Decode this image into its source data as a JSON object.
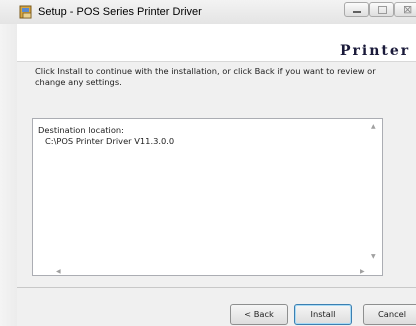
{
  "window": {
    "title": "Setup - POS Series Printer Driver",
    "controls": {
      "minimize": "minimize-icon",
      "maximize": "maximize-icon",
      "close": "close-icon",
      "close_glyph": "⊠"
    }
  },
  "header": {
    "title": "Printer"
  },
  "body": {
    "instructions": "Click Install to continue with the installation, or click Back if you want to review or change any settings.",
    "destination_label": "Destination location:",
    "destination_path": "C:\\POS Printer Driver V11.3.0.0"
  },
  "buttons": {
    "back": "< Back",
    "install": "Install",
    "cancel": "Cancel"
  },
  "scroll_arrows": {
    "up": "▲",
    "down": "▼",
    "left": "◀",
    "right": "▶"
  }
}
